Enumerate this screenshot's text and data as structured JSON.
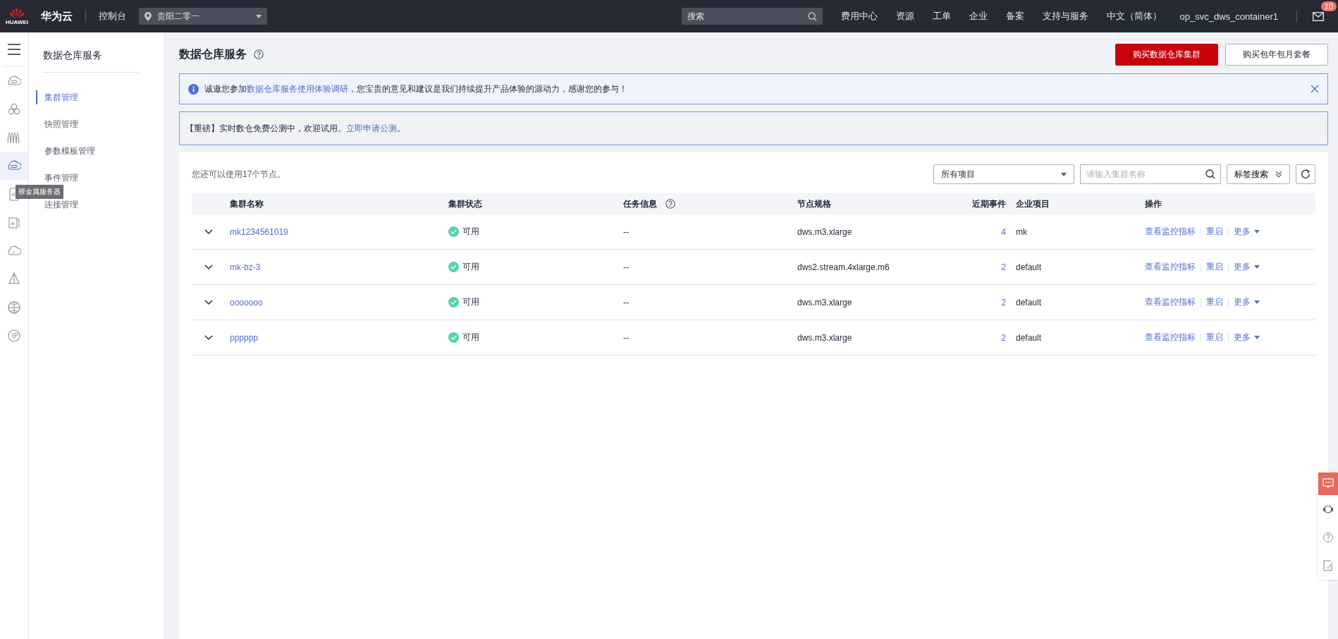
{
  "topbar": {
    "logo_text": "HUAWEI",
    "brand": "华为云",
    "console": "控制台",
    "region": "贵阳二零一",
    "search": {
      "placeholder": "搜索"
    },
    "links": [
      "费用中心",
      "资源",
      "工单",
      "企业",
      "备案",
      "支持与服务",
      "中文（简体）",
      "op_svc_dws_container1"
    ],
    "mail_badge": "10"
  },
  "rail": {
    "items": [
      {
        "kind": "cloud-server",
        "selected": false
      },
      {
        "kind": "cluster",
        "selected": false
      },
      {
        "kind": "waves",
        "selected": false
      },
      {
        "kind": "cloud-server",
        "selected": true
      },
      {
        "kind": "device",
        "selected": false
      },
      {
        "kind": "cards",
        "selected": false
      },
      {
        "kind": "cloud-gauge",
        "selected": false
      },
      {
        "kind": "tent",
        "selected": false
      },
      {
        "kind": "globe",
        "selected": false
      },
      {
        "kind": "circle",
        "selected": false
      }
    ],
    "tooltip": "裸金属服务器"
  },
  "sidenav": {
    "title": "数据仓库服务",
    "items": [
      {
        "label": "集群管理",
        "selected": true
      },
      {
        "label": "快照管理",
        "selected": false
      },
      {
        "label": "参数模板管理",
        "selected": false
      },
      {
        "label": "事件管理",
        "selected": false
      },
      {
        "label": "连接管理",
        "selected": false
      }
    ]
  },
  "page": {
    "title": "数据仓库服务",
    "buttons": [
      {
        "label": "购买数据仓库集群",
        "kind": "primary"
      },
      {
        "label": "购买包年包月套餐",
        "kind": "secondary"
      }
    ]
  },
  "notices": [
    {
      "kind": "info",
      "prefix": "诚邀您参加",
      "link": "数据仓库服务使用体验调研",
      "suffix": "，您宝贵的意见和建议是我们持续提升产品体验的源动力，感谢您的参与！",
      "closable": true
    },
    {
      "kind": "plain",
      "prefix": "【重磅】实时数仓免费公测中，欢迎试用。",
      "link": "立即申请公测",
      "suffix": "。",
      "closable": false
    }
  ],
  "cluster_panel": {
    "quota": "您还可以使用17个节点。",
    "project_filter": "所有项目",
    "search": {
      "placeholder": "请输入集群名称"
    },
    "tag_search": "标签搜索",
    "table": {
      "columns": [
        "集群名称",
        "集群状态",
        "任务信息",
        "节点规格",
        "近期事件",
        "企业项目",
        "操作"
      ],
      "rows": [
        {
          "expanded": false,
          "name": "mk1234561019",
          "status": "可用",
          "task": "--",
          "spec": "dws.m3.xlarge",
          "events": "4",
          "project": "mk",
          "actions": [
            "查看监控指标",
            "重启",
            "更多"
          ]
        },
        {
          "expanded": false,
          "name": "mk-bz-3",
          "status": "可用",
          "task": "--",
          "spec": "dws2.stream.4xlarge.m6",
          "events": "2",
          "project": "default",
          "actions": [
            "查看监控指标",
            "重启",
            "更多"
          ]
        },
        {
          "expanded": false,
          "name": "ooooooo",
          "status": "可用",
          "task": "--",
          "spec": "dws.m3.xlarge",
          "events": "2",
          "project": "default",
          "actions": [
            "查看监控指标",
            "重启",
            "更多"
          ]
        },
        {
          "expanded": false,
          "name": "pppppp",
          "status": "可用",
          "task": "--",
          "spec": "dws.m3.xlarge",
          "events": "2",
          "project": "default",
          "actions": [
            "查看监控指标",
            "重启",
            "更多"
          ]
        }
      ]
    }
  }
}
